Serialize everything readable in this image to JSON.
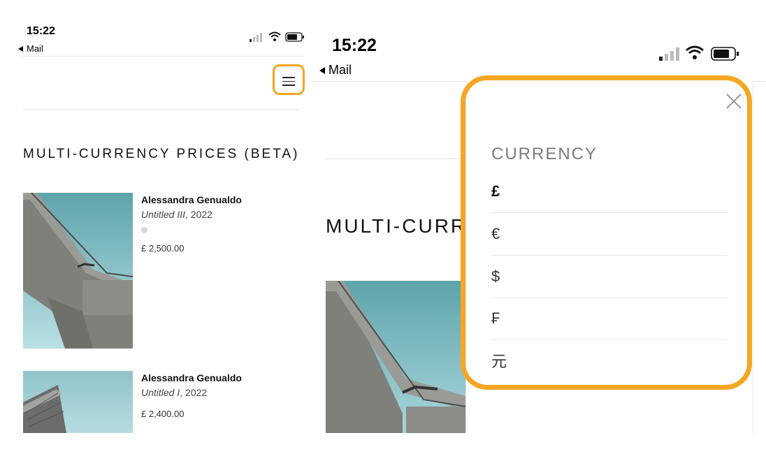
{
  "left_screen": {
    "status": {
      "time": "15:22",
      "back_label": "Mail"
    },
    "section_title": "MULTI-CURRENCY PRICES (BETA)",
    "artworks": [
      {
        "artist": "Alessandra Genualdo",
        "title": "Untitled III",
        "year": ", 2022",
        "price": "£ 2,500.00"
      },
      {
        "artist": "Alessandra Genualdo",
        "title": "Untitled I",
        "year": ", 2022",
        "price": "£ 2,400.00"
      }
    ]
  },
  "right_screen": {
    "status": {
      "time": "15:22",
      "back_label": "Mail"
    },
    "partial_title": "MULTI-CURR",
    "currency_menu": {
      "heading": "CURRENCY",
      "options": [
        "£",
        "€",
        "$",
        "₣",
        "元"
      ]
    }
  },
  "colors": {
    "highlight": "#f5a623",
    "image_sky": "#6aaeb5",
    "concrete": "#8b8b88"
  },
  "icons": [
    "signal-icon",
    "wifi-icon",
    "battery-icon",
    "hamburger-menu-icon",
    "close-icon"
  ]
}
